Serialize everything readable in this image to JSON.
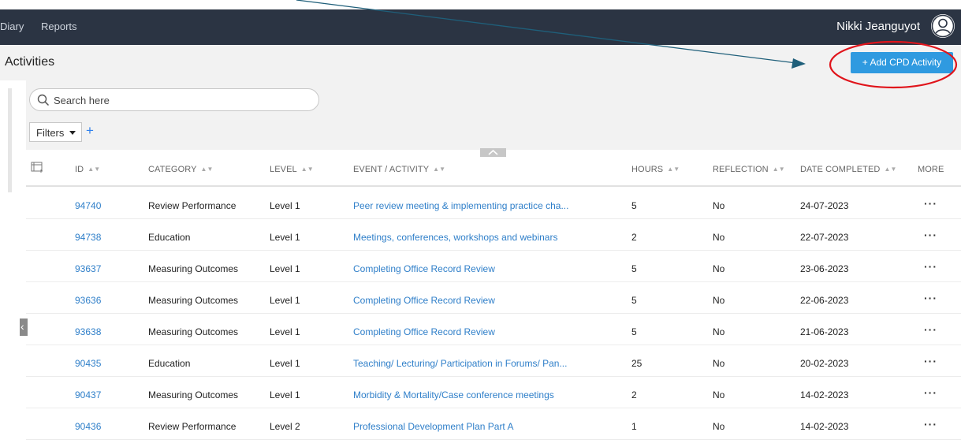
{
  "nav": {
    "items": [
      "Diary",
      "Reports"
    ],
    "user_name": "Nikki Jeanguyot"
  },
  "header": {
    "title": "Activities",
    "add_button": "+ Add CPD Activity"
  },
  "search": {
    "placeholder": "Search here"
  },
  "filters": {
    "label": "Filters",
    "add": "+"
  },
  "table": {
    "columns": [
      "ID",
      "CATEGORY",
      "LEVEL",
      "EVENT / ACTIVITY",
      "HOURS",
      "REFLECTION",
      "DATE COMPLETED",
      "MORE"
    ],
    "rows": [
      {
        "id": "94740",
        "category": "Review Performance",
        "level": "Level 1",
        "event": "Peer review meeting & implementing practice cha...",
        "hours": "5",
        "reflection": "No",
        "date": "24-07-2023"
      },
      {
        "id": "94738",
        "category": "Education",
        "level": "Level 1",
        "event": "Meetings, conferences, workshops and webinars",
        "hours": "2",
        "reflection": "No",
        "date": "22-07-2023"
      },
      {
        "id": "93637",
        "category": "Measuring Outcomes",
        "level": "Level 1",
        "event": "Completing Office Record Review",
        "hours": "5",
        "reflection": "No",
        "date": "23-06-2023"
      },
      {
        "id": "93636",
        "category": "Measuring Outcomes",
        "level": "Level 1",
        "event": "Completing Office Record Review",
        "hours": "5",
        "reflection": "No",
        "date": "22-06-2023"
      },
      {
        "id": "93638",
        "category": "Measuring Outcomes",
        "level": "Level 1",
        "event": "Completing Office Record Review",
        "hours": "5",
        "reflection": "No",
        "date": "21-06-2023"
      },
      {
        "id": "90435",
        "category": "Education",
        "level": "Level 1",
        "event": "Teaching/ Lecturing/ Participation in Forums/ Pan...",
        "hours": "25",
        "reflection": "No",
        "date": "20-02-2023"
      },
      {
        "id": "90437",
        "category": "Measuring Outcomes",
        "level": "Level 1",
        "event": "Morbidity & Mortality/Case conference meetings",
        "hours": "2",
        "reflection": "No",
        "date": "14-02-2023"
      },
      {
        "id": "90436",
        "category": "Review Performance",
        "level": "Level 2",
        "event": "Professional Development Plan Part A",
        "hours": "1",
        "reflection": "No",
        "date": "14-02-2023"
      }
    ],
    "more_glyph": "···"
  },
  "colors": {
    "nav_bg": "#2b3443",
    "accent": "#2f9ae0",
    "link": "#2f7fc9",
    "annotation_arrow": "#1f5f7a",
    "annotation_circle": "#e0141b"
  },
  "icons": [
    "search-icon",
    "user-avatar-icon",
    "column-settings-icon",
    "chevron-up-icon",
    "chevron-left-icon",
    "sort-icon",
    "more-icon"
  ]
}
